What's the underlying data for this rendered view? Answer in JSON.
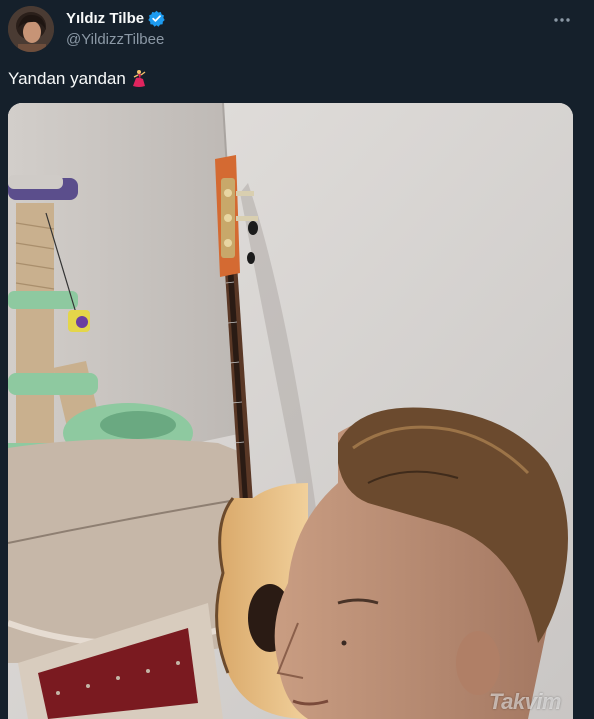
{
  "user": {
    "display_name": "Yıldız Tilbe",
    "handle": "@YildizzTilbee",
    "verified": true
  },
  "tweet": {
    "text": "Yandan yandan",
    "emoji": "dancer-icon"
  },
  "media": {
    "description_icon": "photo-guitar-woman",
    "watermark": "Takvim"
  },
  "colors": {
    "background": "#15202b",
    "verified": "#1d9bf0",
    "muted": "#8b98a5"
  }
}
